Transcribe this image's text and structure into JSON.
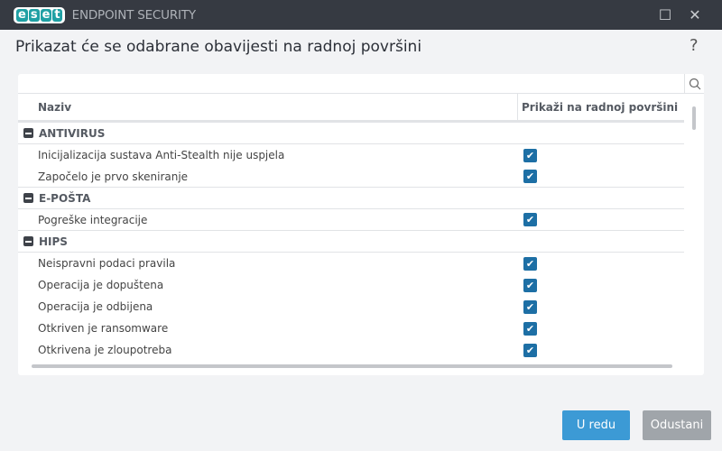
{
  "window": {
    "logo": [
      "e",
      "s",
      "e",
      "t"
    ],
    "app_title": "ENDPOINT SECURITY"
  },
  "heading": "Prikazat će se odabrane obavijesti na radnoj površini",
  "help": "?",
  "table": {
    "columns": [
      "Naziv",
      "Prikaži na radnoj površini"
    ],
    "groups": [
      {
        "name": "ANTIVIRUS",
        "items": [
          {
            "label": "Inicijalizacija sustava Anti-Stealth nije uspjela",
            "checked": true
          },
          {
            "label": "Započelo je prvo skeniranje",
            "checked": true
          }
        ]
      },
      {
        "name": "E-POŠTA",
        "items": [
          {
            "label": "Pogreške integracije",
            "checked": true
          }
        ]
      },
      {
        "name": "HIPS",
        "items": [
          {
            "label": "Neispravni podaci pravila",
            "checked": true
          },
          {
            "label": "Operacija je dopuštena",
            "checked": true
          },
          {
            "label": "Operacija je odbijena",
            "checked": true
          },
          {
            "label": "Otkriven je ransomware",
            "checked": true
          },
          {
            "label": "Otkrivena je zloupotreba",
            "checked": true
          }
        ]
      }
    ]
  },
  "buttons": {
    "ok": "U redu",
    "cancel": "Odustani"
  }
}
